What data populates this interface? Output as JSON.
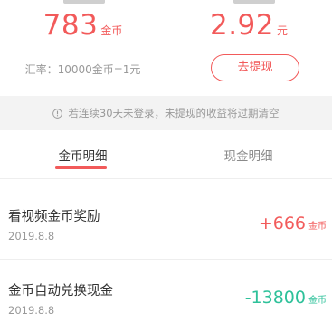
{
  "summary": {
    "coins_value": "783",
    "coins_unit": "金币",
    "cash_value": "2.92",
    "cash_unit": "元",
    "exchange_rate": "汇率：10000金币=1元",
    "withdraw_label": "去提现"
  },
  "notice": {
    "icon": "info-circle-icon",
    "text": "若连续30天未登录，未提现的收益将过期清空"
  },
  "tabs": [
    {
      "label": "金币明细",
      "active": true
    },
    {
      "label": "现金明细",
      "active": false
    }
  ],
  "records": [
    {
      "title": "看视频金币奖励",
      "date": "2019.8.8",
      "amount": "+666",
      "unit": "金币"
    },
    {
      "title": "金币自动兑换现金",
      "date": "2019.8.8",
      "amount": "-13800",
      "unit": "金币"
    }
  ],
  "colors": {
    "accent": "#f25a5a",
    "positive": "#f25a5a",
    "negative": "#2ec19a",
    "notice_bg": "#f3f3f3"
  }
}
